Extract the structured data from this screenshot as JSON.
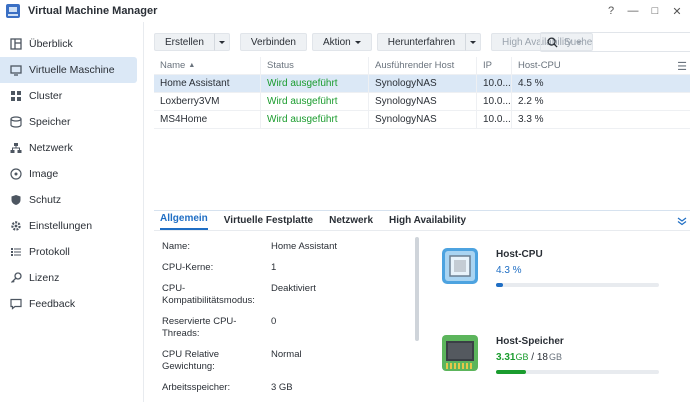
{
  "window": {
    "title": "Virtual Machine Manager",
    "help_icon": "?",
    "minimize_icon": "—",
    "maximize_icon": "□",
    "close_icon": "✕"
  },
  "sidebar": {
    "items": [
      {
        "label": "Überblick",
        "icon": "overview-icon",
        "active": false
      },
      {
        "label": "Virtuelle Maschine",
        "icon": "vm-icon",
        "active": true
      },
      {
        "label": "Cluster",
        "icon": "cluster-icon",
        "active": false
      },
      {
        "label": "Speicher",
        "icon": "storage-icon",
        "active": false
      },
      {
        "label": "Netzwerk",
        "icon": "network-icon",
        "active": false
      },
      {
        "label": "Image",
        "icon": "image-icon",
        "active": false
      },
      {
        "label": "Schutz",
        "icon": "shield-icon",
        "active": false
      },
      {
        "label": "Einstellungen",
        "icon": "gear-icon",
        "active": false
      },
      {
        "label": "Protokoll",
        "icon": "log-icon",
        "active": false
      },
      {
        "label": "Lizenz",
        "icon": "key-icon",
        "active": false
      },
      {
        "label": "Feedback",
        "icon": "feedback-icon",
        "active": false
      }
    ]
  },
  "toolbar": {
    "create_label": "Erstellen",
    "connect_label": "Verbinden",
    "action_label": "Aktion",
    "shutdown_label": "Herunterfahren",
    "ha_label": "High Availability"
  },
  "search": {
    "placeholder": "Suche"
  },
  "table": {
    "headers": {
      "name": "Name",
      "status": "Status",
      "host": "Ausführender Host",
      "ip": "IP",
      "cpu": "Host-CPU"
    },
    "rows": [
      {
        "name": "Home Assistant",
        "status": "Wird ausgeführt",
        "host": "SynologyNAS",
        "ip": "10.0...",
        "cpu": "4.5 %"
      },
      {
        "name": "Loxberry3VM",
        "status": "Wird ausgeführt",
        "host": "SynologyNAS",
        "ip": "10.0...",
        "cpu": "2.2 %"
      },
      {
        "name": "MS4Home",
        "status": "Wird ausgeführt",
        "host": "SynologyNAS",
        "ip": "10.0...",
        "cpu": "3.3 %"
      }
    ]
  },
  "detail": {
    "tabs": [
      "Allgemein",
      "Virtuelle Festplatte",
      "Netzwerk",
      "High Availability"
    ],
    "properties": {
      "name_label": "Name:",
      "name_value": "Home Assistant",
      "cores_label": "CPU-Kerne:",
      "cores_value": "1",
      "compat_label_1": "CPU-",
      "compat_label_2": "Kompatibilitätsmodus:",
      "compat_value": "Deaktiviert",
      "reserved_label_1": "Reservierte CPU-",
      "reserved_label_2": "Threads:",
      "reserved_value": "0",
      "weight_label_1": "CPU Relative",
      "weight_label_2": "Gewichtung:",
      "weight_value": "Normal",
      "memory_label": "Arbeitsspeicher:",
      "memory_value": "3 GB"
    },
    "host_cpu": {
      "title": "Host-CPU",
      "value": "4.3",
      "unit": " %",
      "level": 0.043,
      "color": "#1f6ec4"
    },
    "host_memory": {
      "title": "Host-Speicher",
      "used": "3.31",
      "used_unit": "GB",
      "separator": " / ",
      "total": "18",
      "total_unit": "GB",
      "level": 0.184,
      "color": "#1a9c2e"
    }
  }
}
